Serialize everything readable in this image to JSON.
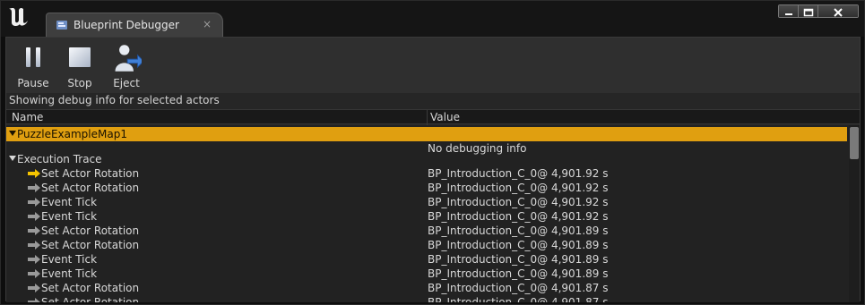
{
  "window": {
    "tab_title": "Blueprint Debugger",
    "tab_close": "×"
  },
  "toolbar": {
    "pause_label": "Pause",
    "stop_label": "Stop",
    "eject_label": "Eject"
  },
  "status_text": "Showing debug info for selected actors",
  "columns": {
    "name": "Name",
    "value": "Value"
  },
  "tree": {
    "map_row": {
      "name": "PuzzleExampleMap1"
    },
    "no_debug": {
      "value": "No debugging info"
    },
    "trace_header": {
      "name": "Execution Trace"
    },
    "trace_rows": [
      {
        "name": "Set Actor Rotation",
        "value": "BP_Introduction_C_0@ 4,901.92 s",
        "arrow": "yellow"
      },
      {
        "name": "Set Actor Rotation",
        "value": "BP_Introduction_C_0@ 4,901.92 s",
        "arrow": "gray"
      },
      {
        "name": "Event Tick",
        "value": "BP_Introduction_C_0@ 4,901.92 s",
        "arrow": "gray"
      },
      {
        "name": "Event Tick",
        "value": "BP_Introduction_C_0@ 4,901.92 s",
        "arrow": "gray"
      },
      {
        "name": "Set Actor Rotation",
        "value": "BP_Introduction_C_0@ 4,901.89 s",
        "arrow": "gray"
      },
      {
        "name": "Set Actor Rotation",
        "value": "BP_Introduction_C_0@ 4,901.89 s",
        "arrow": "gray"
      },
      {
        "name": "Event Tick",
        "value": "BP_Introduction_C_0@ 4,901.89 s",
        "arrow": "gray"
      },
      {
        "name": "Event Tick",
        "value": "BP_Introduction_C_0@ 4,901.89 s",
        "arrow": "gray"
      },
      {
        "name": "Set Actor Rotation",
        "value": "BP_Introduction_C_0@ 4,901.87 s",
        "arrow": "gray"
      },
      {
        "name": "Set Actor Rotation",
        "value": "BP_Introduction_C_0@ 4,901.87 s",
        "arrow": "gray"
      }
    ]
  },
  "colors": {
    "selected_row": "#e09f10",
    "active_arrow": "#f5c400",
    "inactive_arrow": "#9a9a9a"
  },
  "icons": {
    "logo": "unreal-engine-logo",
    "tab": "blueprint-debugger-icon",
    "pause": "pause-icon",
    "stop": "stop-icon",
    "eject": "eject-icon"
  }
}
